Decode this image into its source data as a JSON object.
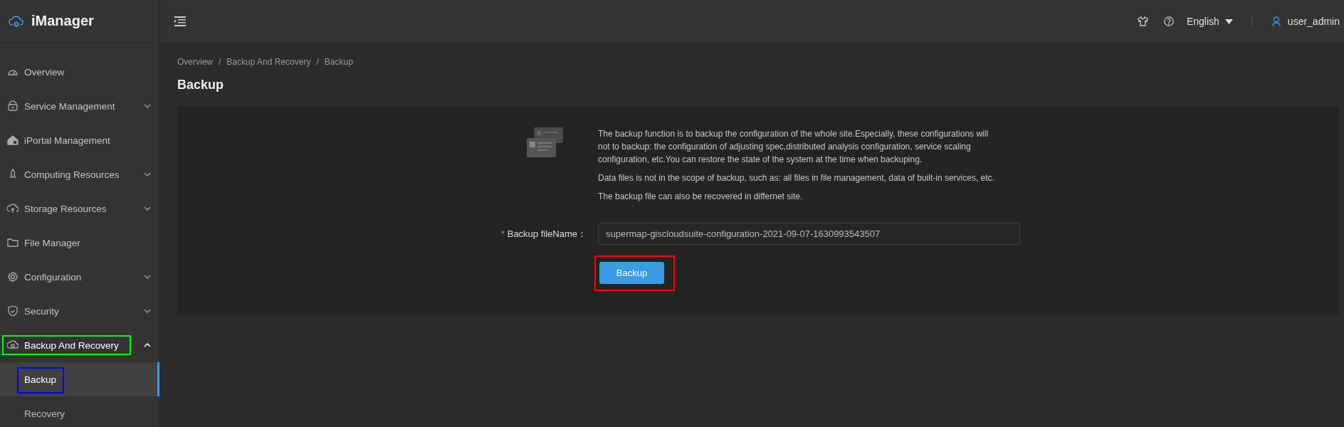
{
  "app": {
    "name": "iManager"
  },
  "sidebar": {
    "items": [
      {
        "label": "Overview",
        "selected": false
      },
      {
        "label": "Service Management",
        "selected": false,
        "expanded": false
      },
      {
        "label": "iPortal Management",
        "selected": false
      },
      {
        "label": "Computing Resources",
        "selected": false,
        "expanded": false
      },
      {
        "label": "Storage Resources",
        "selected": false,
        "expanded": false
      },
      {
        "label": "File Manager",
        "selected": false
      },
      {
        "label": "Configuration",
        "selected": false,
        "expanded": false
      },
      {
        "label": "Security",
        "selected": false,
        "expanded": false
      },
      {
        "label": "Backup And Recovery",
        "selected": true,
        "expanded": true,
        "color": "#00ff00",
        "children": [
          {
            "label": "Backup",
            "selected": true,
            "color": "#0000ff"
          },
          {
            "label": "Recovery",
            "selected": false
          }
        ]
      }
    ]
  },
  "header": {
    "language": "English",
    "user": "user_admin"
  },
  "breadcrumb": {
    "items": [
      "Overview",
      "Backup And Recovery",
      "Backup"
    ],
    "separator": "/"
  },
  "page_title": "Backup",
  "panel": {
    "paragraphs": [
      "The backup function is to backup the configuration of the whole site.Especially, these configurations will not to backup: the configuration of adjusting spec,distributed analysis configuration, service scaling configuration, etc.You can restore the state of the system at the time when backuping.",
      "Data files is not in the scope of backup, such as: all files in file management, data of built-in services, etc.",
      "The backup file can also be recovered in differnet site."
    ],
    "form": {
      "required_mark": "*",
      "label": "Backup fileName：",
      "value": "supermap-giscloudsuite-configuration-2021-09-07-1630993543507"
    },
    "button": {
      "label": "Backup",
      "color": "#ff0000"
    }
  }
}
